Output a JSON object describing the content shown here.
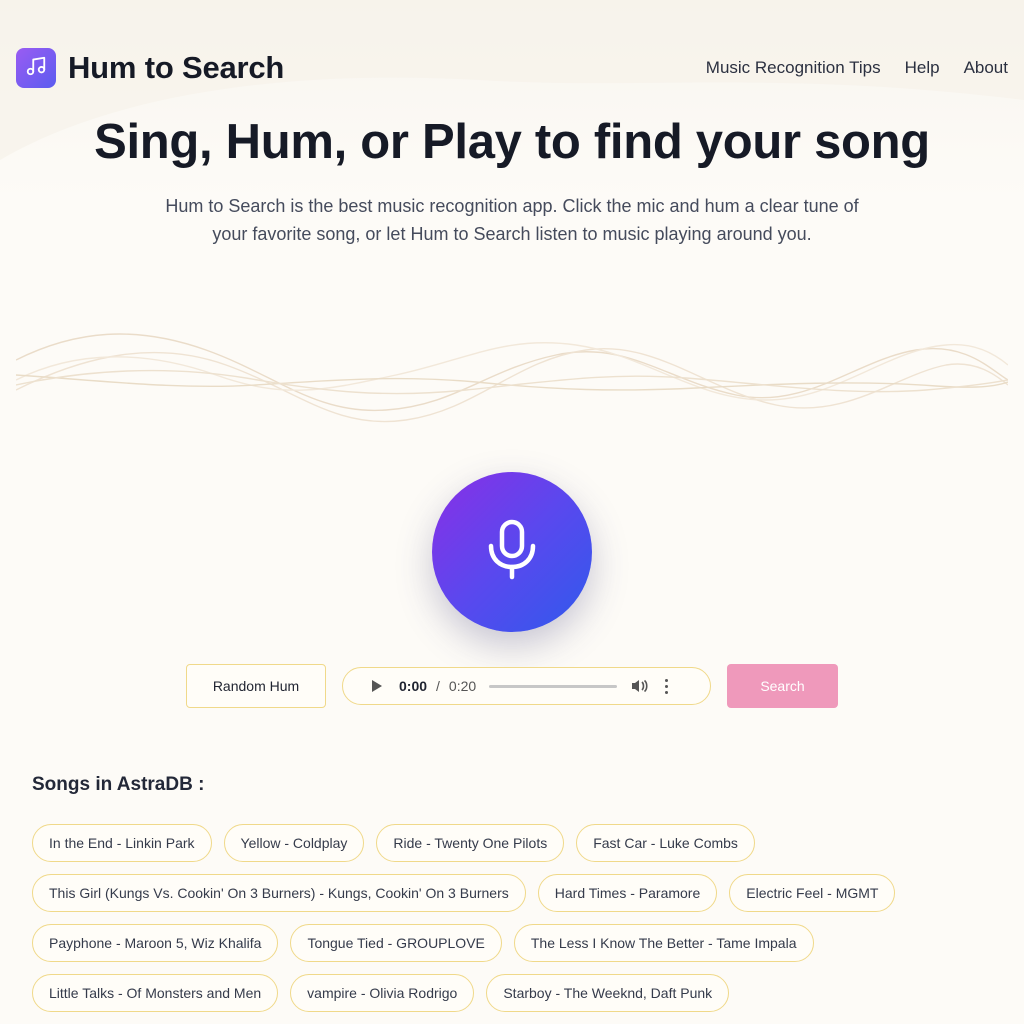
{
  "header": {
    "brand": "Hum to Search",
    "logo_icon": "music-note-icon",
    "nav": [
      {
        "label": "Music Recognition Tips"
      },
      {
        "label": "Help"
      },
      {
        "label": "About"
      }
    ]
  },
  "hero": {
    "title": "Sing, Hum, or Play to find your song",
    "subtitle": "Hum to Search is the best music recognition app. Click the mic and hum a clear tune of your favorite song, or let Hum to Search listen to music playing around you."
  },
  "mic": {
    "icon": "microphone-icon"
  },
  "controls": {
    "random_label": "Random Hum",
    "player": {
      "current": "0:00",
      "separator": "/",
      "duration": "0:20",
      "progress": 0.0
    },
    "search_label": "Search"
  },
  "songs": {
    "title": "Songs in AstraDB :",
    "rows": [
      [
        "In the End - Linkin Park",
        "Yellow - Coldplay",
        "Ride - Twenty One Pilots",
        "Fast Car - Luke Combs"
      ],
      [
        "This Girl (Kungs Vs. Cookin' On 3 Burners) - Kungs, Cookin' On 3 Burners",
        "Hard Times - Paramore",
        "Electric Feel - MGMT"
      ],
      [
        "Payphone - Maroon 5, Wiz Khalifa",
        "Tongue Tied - GROUPLOVE",
        "The Less I Know The Better - Tame Impala"
      ],
      [
        "Little Talks - Of Monsters and Men",
        "vampire - Olivia Rodrigo",
        "Starboy - The Weeknd, Daft Punk"
      ]
    ]
  },
  "colors": {
    "accent_purple": "#8a2fe6",
    "accent_blue": "#2f5aec",
    "chip_border": "#f0d98a",
    "search_button": "#ef99bb"
  }
}
